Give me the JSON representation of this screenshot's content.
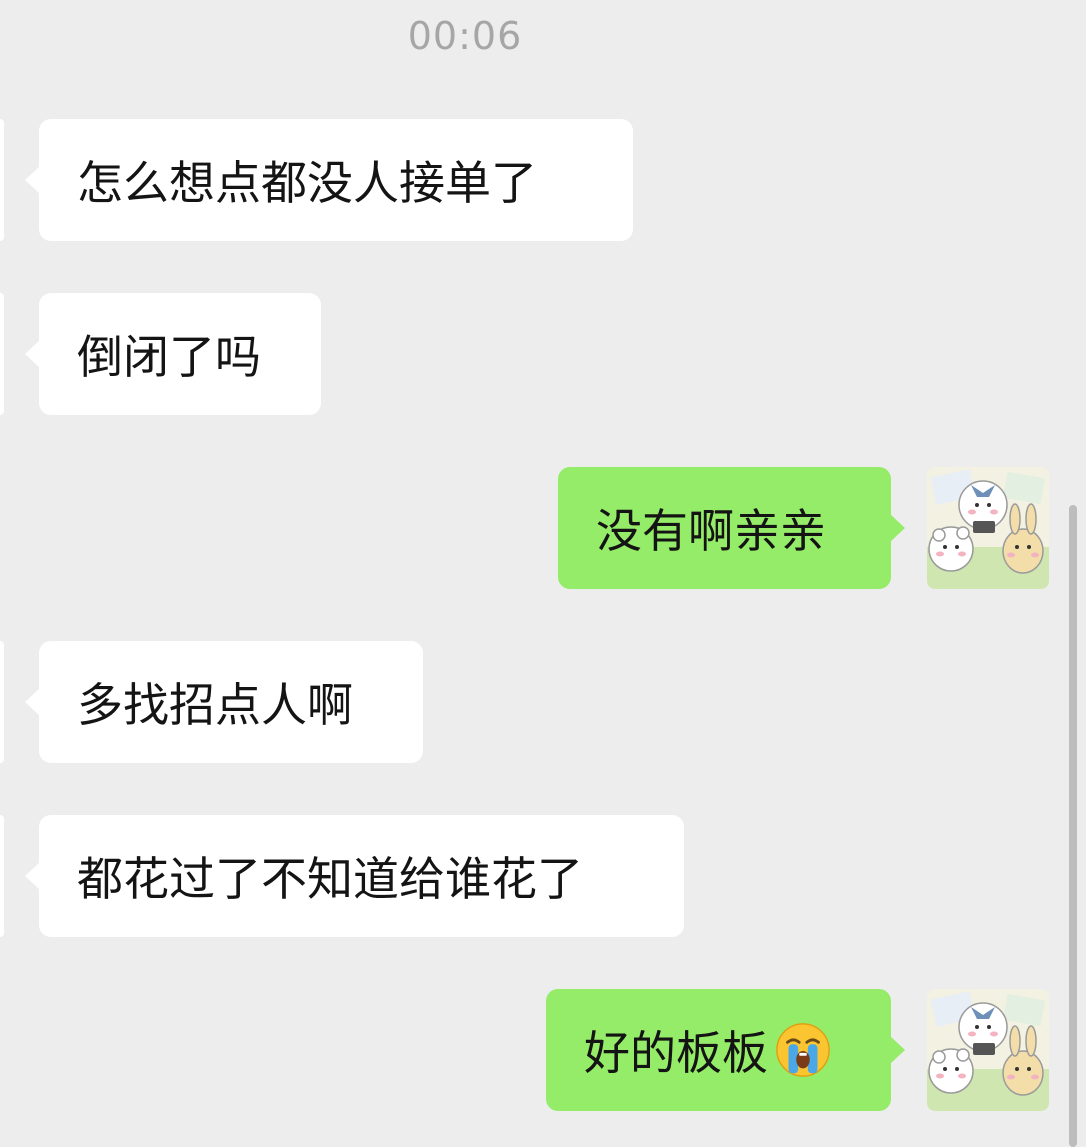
{
  "timestamp": "00:06",
  "messages": [
    {
      "side": "left",
      "text": "怎么想点都没人接单了"
    },
    {
      "side": "left",
      "text": "倒闭了吗"
    },
    {
      "side": "right",
      "text": "没有啊亲亲"
    },
    {
      "side": "left",
      "text": "多找招点人啊"
    },
    {
      "side": "left",
      "text": "都花过了不知道给谁花了"
    },
    {
      "side": "right",
      "text": "好的板板",
      "emoji": "crying-face-icon"
    }
  ],
  "colors": {
    "background": "#ededed",
    "incoming_bubble": "#ffffff",
    "outgoing_bubble": "#95ec69",
    "timestamp_text": "#a6a6a6"
  }
}
